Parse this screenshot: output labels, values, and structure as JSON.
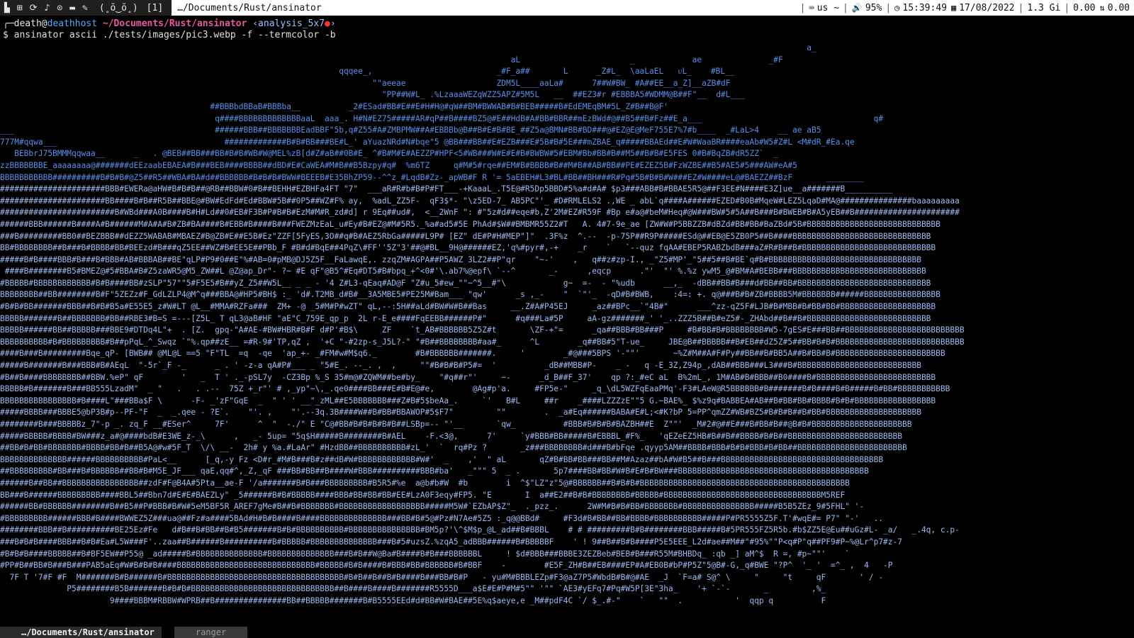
{
  "topbar": {
    "workspace_indicator": "[1]",
    "face": "(˳ŏ‿ŏ˳)",
    "window_title": "…/Documents/Rust/ansinator",
    "keyboard_layout": "us ~",
    "volume": "95%",
    "time": "15:39:49",
    "date": "17/08/2022",
    "memory": "1.3 Gi",
    "load": "0.00",
    "net": "0.00"
  },
  "prompt": {
    "user": "death",
    "host": "deathhost",
    "path": "~/Documents/Rust/ansinator",
    "branch": "‹analysis_5x7",
    "command": "$ ansinator ascii ./tests/images/pic3.webp -f --termcolor -b"
  },
  "art_lines": [
    "                                                                                                                                                                         a_",
    "                                                                                                           aL                       _            ae              _#F",
    "                                                                       qqqee_,                          _#F_a##       L      _Z#L_  \\aaLaEL   ᴜL_    #BL__",
    "                                                                              \"\"aeeae                   ZDM5L____aaLa#      7##W#BW_ #A##EE__a_Z]__aZB#dF",
    "                                                                                \"PP##W#L_ .%LzaaaWEZqWZZ5APZ#5M5L   __  ##EZ3#r #EBBBA5#WDMM@B##F\"__  d#L___",
    "                                            ##BBBbdBBaB#BBBba__          _2#ESad#BB#E##E#H#H@#qW##BM#BWWAB#B#BEB#####B#EdEMEqBM#5L_Z#B##B@F'",
    "                                             q####BBBBBBBBBBBBBaaL  aaa_. H#N#EZ75#####AR#qP##B####BZ5@#E##HdB#A#BB#BBR##mEzBWd#@##B5##B#Fz##E_a___                                    q#",
    "___                                          ######BBB##BBBBBBBEadBBF\"5b,q#Z55#A#ZMBPMW##A#EBBBb@B##B#E#B#BE_##Z5a@BMN#BB#BD###@#EZ@E@MeF755E7%7#b____  _#LaL>4    __ ae aB5",
    "777M#qqwa___                                   #############B#B#BB###BE#L_' aYuazNRd#N#bqe\"5 @BB###BB##E#EZB###E#5B#B#5E###mZBAE_q#####BBAEd##E#W#WaaBR####eaAb#W5#Z#L <M#dR_#Ea.qe",
    "   BEBbrJ75BMMMqqwaa__      _   . @BEB##BB###BB#B#B#WB#W@MEL%zB[d#Z#aB##0B#E_ ^#B#M#E#AEZZP#HPF<5#WB###W#E#E#B#BWBW#5#EBM#Bb#BB#B##M5##B#B#E5FES 0#B#BqZB#dR5ZZ`  _",
    "zzBBBBBBBE_aaaaaaaa@#######dEEzaabEBAEA#B###BEB####BBBB##dBD#E#CaWEA#M#B##B5Bzpy#q#  %m6TZ     q#M#5#rqe##EM#B#BBBB#B##M#B##AB#BB##PE#EZEZ5B#FzWZBE##B5#AE5#5###AW#eA#5",
    "BBBBBBBBBBB##########B#B#B#@Z5##R5##WBA#BA#d##BBBBBB#B#B#B#BWW#BEEEB#E35BhZP59--^^z_#LqdB#Zz-_apWB#F R '= 5aEBEH#L3#BL#BB##BH###R#Pq#5B#B#B#W###EZ#W####eL@#BAEZZ##BzF       ________",
    "######################BBB#EWERa@aHW#B#B#B##@RB##BBW#0#B##BEHH#EZBHFa4FT \"7\"  ___aR#R#b#B#P#FT___-+KaaaL_.T5E@#R5Dp5BBD#5%a#d#A# $p3###ABB#B#BBAE5R5@##F3EE#N####E3Z]ue__a#######B__________",
    "######################BB####B#B##R5B##BBE@#BW#EdFd#Ed#BBW#5B##0P5##WZ#F% ay,  %adL_ZZ5F-  qF3$*- \"\\z5ED-7_ AB5PC\"'_ #D#RMLELS2 .,WE _ abL`q####A######EZED#B0B#MqeW#LEZ5LqaD#MA@###############baaaaaaaaa",
    "########################B#WBd###A0B####B#H#Ld##0#EB#F3B#P#B#B#EzM#M#R_zd#d] r 9Eq##ud#,  <__2WnF \": #\"5z#d##eqe#b,Z'2M#EZ#R59F #Bp e#a@#beM#Heq#@W###BW#5#5A##B###B#BWEB#B#A5yEB##B######################",
    "######BBB######B####A#B######M#A#A#B#ZB#BA####B#EBB#B####B###FWEZMzEaL_u#Ey#B#EZ@#M#5R5._%a#ad5#5E PhAd#$W##BMBMR55Z2#T   A. 4#7-9e_ae [ZW#W#P5BBZZB#dBZd#BB#BB#BaZBd#5B#BBBBBBBBBBBBBBBBBBBBBBBBBBBB",
    "###B#########BB0##BEZBBB##dEZZ5WABAB#MBAEZ#B@ZB#E##E5B#Ez\"ZZF[5FyES,3O##q#B#AEZ5RbGa#####L9P# [EZ\" dE#P#H#MEP\"]\"  .3F%z  ^.--  -p-75P##R9P#####ESd@##EB@E5ZB0P5##B####BBBBBBBBBBBBBBBBBBBBBBBBBBBBB",
    "BB#BBBBBBBB##B###B#BBBB#BB#BEEzd#B###qZ5EE##WZ#B#EE5E##PBb_F #B#d#BqE##4PqZ\\#FF''5Z\"3'##@#BL__9H@######EZ,'q%#pyr#,-+    _r    `   `--quz fqAA#EBEP5RABZbdB###aZ#R#B##B#BBBBBBBBBBBBBBBBBBBBBBBBBBBB",
    "#####B#B####BBB#B###B#BBB#AB#BBBAB##BE\"qLP#P9#0##E\"%#AB=0#pMB@DJ5Z5F__FaLawqE,. zzqZM#AGPA##P5AWZ 3LZ2##P\"qr    \"~-'    ,   q##z#zp-I., _\"Z5#MP'_\"5##5##B#BE`q#B#BBBBBBBBBBBBBBBBBBBBBBBBBBBBBBBB",
    " ####B########B5#BMEZ@#5#BBA#B#Z5zaWR5@M5_ZW##L @Z@ap_Dr\"- ?~ #E qF\"@B5^#Eq#DT5#B#bpq_+^<0#'\\.ab7%@epf\\ `--^       _-      ,eqcp      .\"'  \"' %.%z ywM5_@#BM#A#BEBB###BBBBBBBBBBBBBBBBBBBBBBBBBBBB",
    "#BBBBB#BBBBBBBBBBBB#B#B####BB#zSLP\"57\"\"5#F5E5#B##yZ_Z5##W5L__ _ _ - '4 Z#L3-qEaq#AD@F \"Z#u_5#ew_\"\"~^5__#\"\\            g~  =-  - \"%udb      __,_  -dBB##BB#B###d#BB##BB#BBBBBBBBBBBBBBBBBBBBBBBBBBBB",
    "BBBBBBBB##BB########B#F\"5ZEZz#F_GdLZLP4@M^q###BBA@#HP5#BH$ :_ 'd#.T2MB_d#B#__3A5MBE5#PE25M#Bam___ \"qw'      _s ,_-    \"  `\"'_  -qD#B#BWB,    :4=: +. q@###B#B#ZB#BBBB5M#BBBBBBB######BBBBBBBBBBBBBBBB",
    "#B#B#BB#######BBB##B#B#B5a#E55E5_z#W#LT @L__#MMA#RZFa###  ZM+ -@ _5#M#P#wZT\" qL,--:5H##aLd#BW#W#B##Bas     __.Z#A#P45EJ     _az##BPc__`\"4B#\"      ___^zz-qZ5F#LJB#B#MBB#B#BB#BB#BBBBBBBBBBBBBBBBBBBB",
    "BBBBB#######B##BBBBBBB#BB##RBE3#B=S =---[Z5L_ T qL3@aB#HF \"aE\"C_759E_qp_p  2L r-E_e####FqEEBB######P#\"      #q###La#5P     aA-gz#######_' '_..ZZZ5B##B#eZ5#-_ZHAbd##B##B#BBBBBBBBBBBBBBBBBBBBBBBBBB",
    "BBBBB######BB##BBBBB###BBE9#DTDq4L\"+  . [Z.  gpq-\"A#AE-#BW#HBR#B#F d#P'#B$\\     ZF    `t_AB#BBBBBB5Z5Z#t       \\ZF-+\"=      _qa##BBB#BB###P     #B#BB#B#BBBBBBBB#W5-7gES#E###BB##BBBBBBBBBBBBBBBBBBBBBBBBB",
    "BBBBBBBBBB#B#BBBBBBBBB#B##pPqL_^_Swqz `\"%.qp##zE__ =#R-9#'TP,qZ ,  '+C \"-#2zp-s_J5L?-\" \"#B##BBBBBBBB#aa#_      ^L        _q##BB#5\"T-ue_     JBE@B##BBBBB##B#EB##dZ5Z#5##BB#B#B#BBBBBBBBBBBBBBBBBBBBBBBBBBB",
    "####B###B#########Bqe_qP- [BWB## @ML@L ==5 \"F\"TL  =q  -qe  'ap_+- _#FM#w#M$q6._        #B#BBBBBB#######.     '        _#@###5BPS '-\"\"'       ~%Z#M##A#F#Py##BB##B#BB5A##B#BB#B#BBBBBBBBBBBBBBBBBBBBBBB",
    "#####B#######B###BBB#B#AEqL  \"-5r`_F -_      _ . ' -z-a qA#P#___ _ \"5#E_. --_. ,  ,     \"\"#B#B#B#P5#=  '          _dB##MBB#P-    _ -   q -E_3Z,Z94p_,dAB##BBB###L3###B#BBBBBBBBBBBBBBBBBBBBBBBBBB",
    "#B##B####BBBBBBBB##BBW.%eP\" qF        '   _  T ' ._-pSL7y  -CZ3Bp %_S 35#m@#ZQWM##be#by_    \"#q##r\"'     ~-      _d_B##F_37'    qp ?:_#eC aL  B%2mL_, 1M#AB#B#BBB##B0####B#BBBBBBBBBBBBBBBBBBBBBBBBB",
    "BBBBB#B#######B###BB555LzadM\"  _ \"   .   . .--  75Z +_r\"' # ,_yp\"~\\,_.qe0####BB###E#B#E@#e,        @Ag#p'a.     #FP5e-\"     _q_\\dL5WZFqEaaPMq'-F3#LAeW@R5BBBBBB#B#######B#B####B#B#####B#BB#BBBBBBBBBBB",
    "BBBBBBBBBBBBBBBB#B####L\"###BBa$F \\      -F- _'zF\"GqE  _  \" ' ' __\"_zML##E5BBBBBBB###Z#B#5$beAa_.     `'   B#L     ##r    _####LZZZzE\"\"5 G.~BAE%_ $%z9q#BABBEA#AB##B#BB#BB#BBBB#B#B#BBBBBBBBBBBBBBBBB",
    "#####BBBB###BBBE5@bP3B#p--PF-\"F  _  _.qee - ?E`.    \"'. ,    \"'.--3q.3B####W##B#BB#BBAWOP#5$F7\"         \"\"        .  _a#Eq######BABA#E#L;<#K?bP 5=PP^qmZZ#WB#BZ5#B#B#B##B#BB#BBBBBBBBBBBBBBBBBBBB",
    "########B###BBBBBz_7\"-p _. zq_F __#ESer^     7F'      ^  \"  -./\" E \"C@#BB#B#B#B#B#B##LSBp=-- \"'__       `qw_          #BBB#B#B#B#BAZBH##E  Z\"\"'  _M#2#@##E###B#BB#B##@B#B#BBBBBBBBBBBBBBBBBBBBB",
    "#####BBBBB#BBBB#BW###z_a#@####bdB#E3WE_z-_\\      ,   _- 5up= \"5q$H#####B########B#AEL    -F.<3@,      7'     `y#BBB#BB#####B#EBBBL_#F%_   'qEZeEZ5HB#B##B##BBBB#B#B##BBBBBBBBBBBBBBBBBBBBBBBB",
    "##BB#B#BB#BBBBBBB#BBBB#BB#B##B5A@#w#5F_T  \\/\\ __-  2h# y %a.#LaAr\" #HzdBB##BBBBBBBBBB#zL_'  `  rq#Pz ?       _z###BBBBBBBB#d###B#bFqe .qyyp5AM##BBBB#BBB#B#B#BBB#B#BB##BBBBBBBBBBBBBBBBBBBBBBB",
    "BBBBBBBBBBBBBB######BBBBBBBBBB#PaL<__      [_q,-y Fz <D#r_#M#B###B#z##dB#W#BBBBBBBBBBBB#W#'  _    ,'  \" aL       qZ#B#BB#BB###BB##M#Azaz##bA#W#B5##B###BBBBBBBBBBBBBBBBBBBBBBBBBBBBBBBBBB",
    "##BBBBBBBBB#BB###B#BBBBBB##BB#B#M5E_JF___ qaE,qq#^,_Z,_qF ###BB#BB##B####W#BBB##########BBB#ba'   _\"\"\" 5  _ .       5p7####BB#BB#W#B#E#B#BW###BBBBBBBBBBBBBBBBBBBBBBBBBBBBBBBBBBBBBBBB",
    "######B##BB##BBBBBBBBBBBBBBBB##zdF#F@B4A#5Pta__ae-F '/a#######B#B###BBBBBBBBB#B5R5#%e  a@b#b#W  #b        i  ^$\"LZ\"z\"5@#BBBBBB##B#B#B#BBBBBBBBBBBBBBBBBBBBBBBBBBBBBBBBBBBBBBBBBBBB",
    "BB###B######BBBBBBBBB####BBL5##Bbn7d#E#E#BAEZLy\" _5######B#B#BBBBB####BBB#BB#BB#BB#EE#LzA0F3eqy#FP5. \"E       I  a##E2##B#B#BBBBBBBB#BBBBB#BBBBBBBBBBBBBBBBBBBBBBBBBBBBBBBBBM5REF",
    "######BB#BBBBBB########B##B5##P#BBB#B#W#5eM5BF5R_AREF7gMe#B##B#BBBBBBB#BBBBBBBBBBBBBBBBBB#####M5W#`EZbAP$Z\"_  ._pzz_.      2W#M#B#B#BB#BBBBBBB#BBBBBBBBBBBBBBB#####B5B5ZEz_9#5FHL\" '-",
    "#BBBBBBBBB######BBB#B####BWWEZ5Z###ua@##Fz#a####5BAd#H#B#B####B####BBBBBBBBBBBBBB###BB#B#5@#Pz#N7Ae#5Z5 :_q@@BBd#     #F3d#B#BB##BB#BBBB#BBBBBBBBBB#####P#PR5555Z5F.T'#wqE#= P7\" \"-'   ..",
    "########BBB##B##########BE25Ez#Fe   d#B##B#BB##B#B5#######B#B#BBBBBBBBBB#BBBBBBBBBBBBBBB#BM5p?'\\^$M$p_@L_ad##B#BBBL    # # #########B#B########BBB#####B#5PR555FZ5R5b.#b$ZZ5E@Eu##uGz#L- _a/   _.4q, c.p-",
    "###B#B#B####BBB##B#B#Ea#L5W###F'..zaa##B######B##########B#BBBBB#BBBBBBBBBBBBBB###B#5#uzsZ.%zqA5_adBBB######B#BBBBBF    ' ! 9##B##B#B####P5E5EEE_L2d#ae##M##\"#95%\"\"P<q#P\"q##PF9#P~%@Lr^p7#z-7",
    "#B#B#B####BBBBB##B#BF5EW##P55@ _ad#####B#BBBBBBBBBBBBBB#BBBBBBBBBBBBBB###B#B##W@Ba#B####B#B###BBBBBBL     ! $d#BBB###BBBE3ZEZBeb#BEB#B###R55M#BHBDq_ :qb _] aM^$  R =, #p~\"\"'    `",
    "#PP#B##BB#B###B###PAB5aEq#W#B#B#B####BBBBBBBBBBBBBBBBBBBBBBBBBBBBB#BBBBB#B#B####B#BBB#BB#BBBBBB#B#BBF    -        #E5F_ZH#B##EB####EP#A#EB0B#bP#P5Z\"5@B#-G,_q#BWE \"?P^  '_ '  =^_ ,  4   -P",
    "  7F T '7#F #F  M#######B#B######B#BBBBBBBBBBBBBBBBBBBBBBBBBBBBBBBBBBBBB#B#B##B##B#B####B###BB#B#P   - yu#M#BBBLEZp#F3@aZ7P5#WbdB#B#@#AE  _J  `F=a# S@^ \\     \"     \"t     qF       ' / -",
    "              P5########B5B#######B#B#B#BBBBBBBBBBBBBBBBBBBBBBBBBBBBBB##B####B####B#######R5555D___a$E#E#P#M#5\"\" '\"\" `AE3#yEFq7#Pq#W5P[3E\"3ha_    '+ `-`-       _         ,%_",
    "                       9####BBBM#RBBW#WPRB##B###############BB##BBBBB#######B#B5555EEd#d#BB#W#BAE##5E%q$aeye,e _M##pdF4C `/ $_.#-\"    `   \"\"  .           '  qqp q          F"
  ],
  "art_colors": {
    "sky": "#5b8ee6",
    "midtone": "#9db9f0",
    "sand": "#d6c28c",
    "bright": "#ffffff"
  },
  "tmux": {
    "left_label": "…/Documents/Rust/ansinator",
    "right_label": "ranger"
  }
}
